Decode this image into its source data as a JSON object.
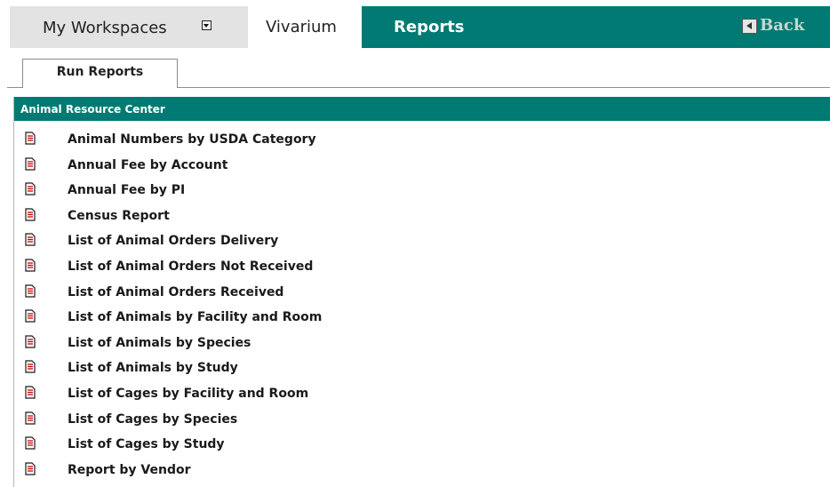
{
  "nav": {
    "workspaces_label": "My Workspaces",
    "vivarium_label": "Vivarium",
    "section_title": "Reports",
    "back_label": "Back"
  },
  "subtabs": {
    "run_reports_label": "Run Reports"
  },
  "panel": {
    "title": "Animal Resource Center",
    "reports": [
      "Animal Numbers by USDA Category",
      "Annual Fee by Account",
      "Annual Fee by PI",
      "Census Report",
      "List of Animal Orders Delivery",
      "List of Animal Orders Not Received",
      "List of Animal Orders Received",
      "List of Animals by Facility and Room",
      "List of Animals by Species",
      "List of Animals by Study",
      "List of Cages by Facility and Room",
      "List of Cages by Species",
      "List of Cages by Study",
      "Report by Vendor"
    ]
  },
  "colors": {
    "teal": "#007a73",
    "icon_red": "#cc0000"
  },
  "icons": {
    "report": "document-icon",
    "dropdown": "dropdown-arrow-icon",
    "back": "back-arrow-icon"
  }
}
